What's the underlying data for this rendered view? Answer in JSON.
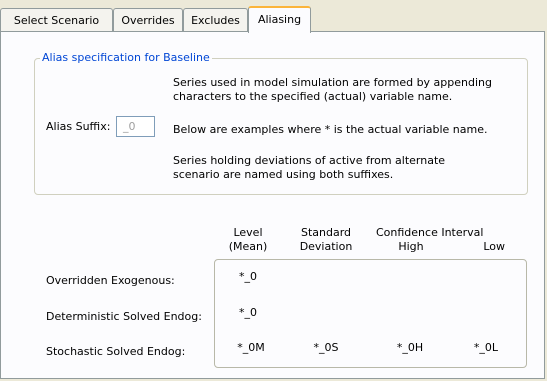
{
  "tabs": [
    {
      "label": "Select Scenario",
      "active": false
    },
    {
      "label": "Overrides",
      "active": false
    },
    {
      "label": "Excludes",
      "active": false
    },
    {
      "label": "Aliasing",
      "active": true
    }
  ],
  "alias_group": {
    "title": "Alias specification for Baseline",
    "suffix_label": "Alias Suffix:",
    "suffix_value": "_0",
    "description_line1": "Series used in model simulation are formed by appending",
    "description_line2": "characters to the specified (actual) variable name.",
    "examples_note": "Below are examples where  *  is the actual variable name.",
    "deviation_note_line1": "Series holding deviations of active from alternate",
    "deviation_note_line2": "scenario are named using both suffixes."
  },
  "examples_table": {
    "headers": {
      "level_line1": "Level",
      "level_line2": "(Mean)",
      "std_line1": "Standard",
      "std_line2": "Deviation",
      "ci_title": "Confidence Interval",
      "ci_high": "High",
      "ci_low": "Low"
    },
    "rows": [
      {
        "label": "Overridden Exogenous:",
        "level": "*_0",
        "std": "",
        "high": "",
        "low": ""
      },
      {
        "label": "Deterministic Solved Endog:",
        "level": "*_0",
        "std": "",
        "high": "",
        "low": ""
      },
      {
        "label": "Stochastic Solved Endog:",
        "level": "*_0M",
        "std": "*_0S",
        "high": "*_0H",
        "low": "*_0L"
      }
    ]
  }
}
